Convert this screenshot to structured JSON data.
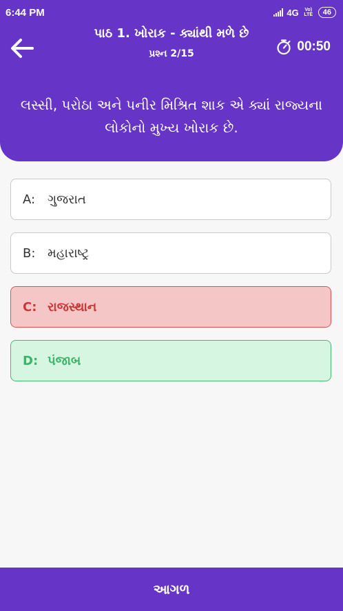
{
  "status_bar": {
    "time": "6:44 PM",
    "network": "4G",
    "volte": "Vo) LTE",
    "battery": "46"
  },
  "header": {
    "title": "પાઠ 1. ખોરાક - ક્યાંથી મળે છે",
    "subtitle": "પ્રશ્ન 2/15",
    "timer": "00:50",
    "back_icon": "arrow-left-icon",
    "timer_icon": "stopwatch-icon"
  },
  "question": {
    "text": "લસ્સી, પરોઠા અને પનીર મિશ્રિત શાક  એ ક્યાં રાજ્યના લોકોનો મુખ્ય ખોરાક છે."
  },
  "options": [
    {
      "letter": "A:",
      "text": "ગુજરાત",
      "state": "default"
    },
    {
      "letter": "B:",
      "text": "મહારાષ્ટ્ર",
      "state": "default"
    },
    {
      "letter": "C:",
      "text": "રાજસ્થાન",
      "state": "wrong"
    },
    {
      "letter": "D:",
      "text": "પંજાબ",
      "state": "correct"
    }
  ],
  "footer": {
    "next_label": "આગળ"
  },
  "colors": {
    "primary": "#6634c6",
    "wrong_bg": "#f5c6c6",
    "wrong_text": "#c83838",
    "correct_bg": "#d6f6e2",
    "correct_text": "#3bb468"
  }
}
